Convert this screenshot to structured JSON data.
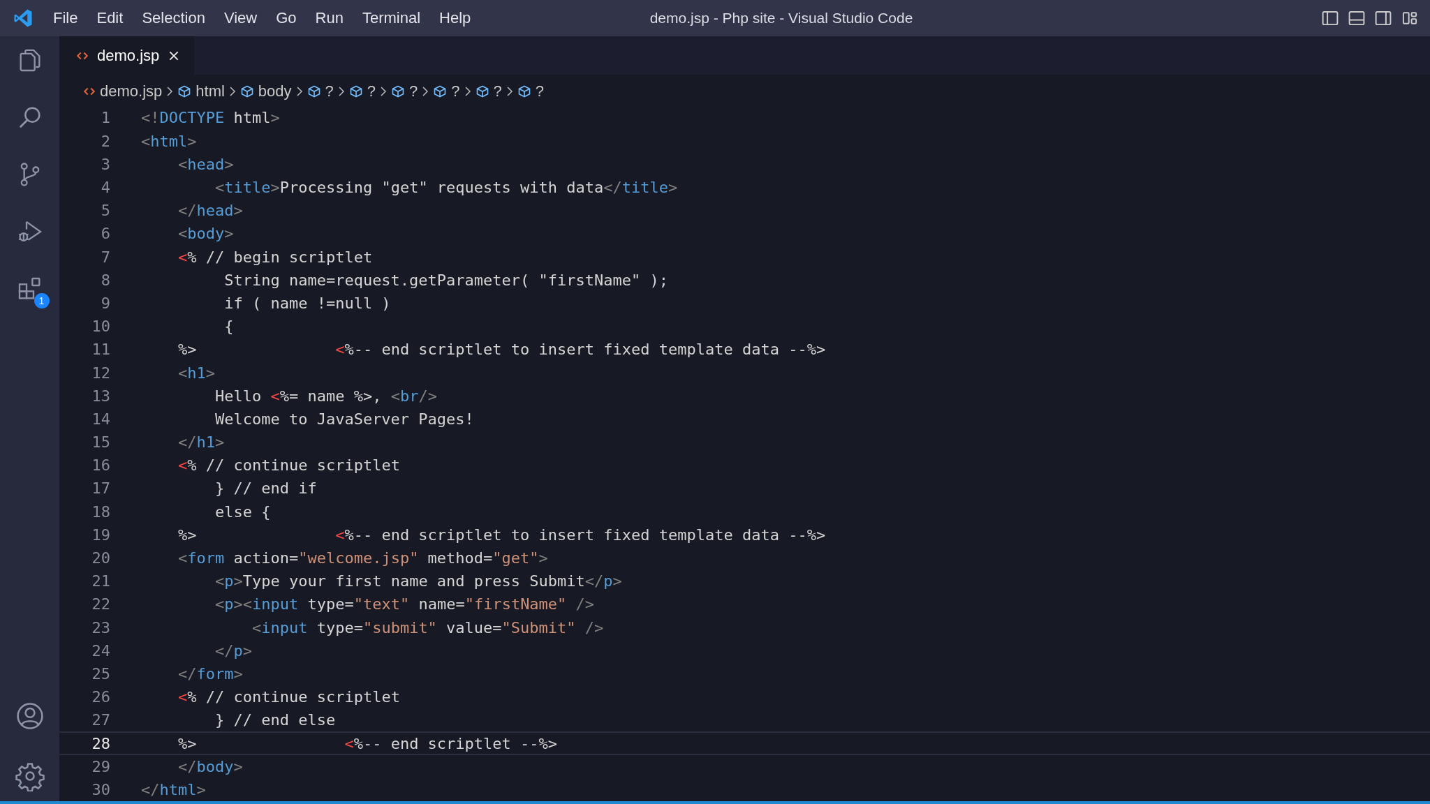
{
  "menu": [
    "File",
    "Edit",
    "Selection",
    "View",
    "Go",
    "Run",
    "Terminal",
    "Help"
  ],
  "window": {
    "title": "demo.jsp - Php site - Visual Studio Code"
  },
  "activity_bar": {
    "top": [
      {
        "kind": "explorer"
      },
      {
        "kind": "search"
      },
      {
        "kind": "source-control"
      },
      {
        "kind": "run-debug"
      },
      {
        "kind": "extensions",
        "badge": "1"
      }
    ],
    "bottom": [
      {
        "kind": "account"
      },
      {
        "kind": "settings"
      }
    ]
  },
  "tabs": [
    {
      "label": "demo.jsp",
      "selected": true
    }
  ],
  "breadcrumbs": [
    {
      "kind": "file",
      "label": "demo.jsp"
    },
    {
      "kind": "element",
      "label": "html"
    },
    {
      "kind": "element",
      "label": "body"
    },
    {
      "kind": "element",
      "label": "?"
    },
    {
      "kind": "element",
      "label": "?"
    },
    {
      "kind": "element",
      "label": "?"
    },
    {
      "kind": "element",
      "label": "?"
    },
    {
      "kind": "element",
      "label": "?"
    },
    {
      "kind": "element",
      "label": "?"
    }
  ],
  "editor": {
    "lines": [
      {
        "number": "1",
        "current": false,
        "tokens": [
          {
            "kind": "punct",
            "text": "<!"
          },
          {
            "kind": "tag",
            "text": "DOCTYPE"
          },
          {
            "kind": "text",
            "text": " html"
          },
          {
            "kind": "punct",
            "text": ">"
          }
        ]
      },
      {
        "number": "2",
        "current": false,
        "tokens": [
          {
            "kind": "punct",
            "text": "<"
          },
          {
            "kind": "tag",
            "text": "html"
          },
          {
            "kind": "punct",
            "text": ">"
          }
        ]
      },
      {
        "number": "3",
        "current": false,
        "tokens": [
          {
            "kind": "punct",
            "text": "    <"
          },
          {
            "kind": "tag",
            "text": "head"
          },
          {
            "kind": "punct",
            "text": ">"
          }
        ]
      },
      {
        "number": "4",
        "current": false,
        "tokens": [
          {
            "kind": "punct",
            "text": "        <"
          },
          {
            "kind": "tag",
            "text": "title"
          },
          {
            "kind": "punct",
            "text": ">"
          },
          {
            "kind": "text",
            "text": "Processing \"get\" requests with data"
          },
          {
            "kind": "punct",
            "text": "</"
          },
          {
            "kind": "tag",
            "text": "title"
          },
          {
            "kind": "punct",
            "text": ">"
          }
        ]
      },
      {
        "number": "5",
        "current": false,
        "tokens": [
          {
            "kind": "punct",
            "text": "    </"
          },
          {
            "kind": "tag",
            "text": "head"
          },
          {
            "kind": "punct",
            "text": ">"
          }
        ]
      },
      {
        "number": "6",
        "current": false,
        "tokens": [
          {
            "kind": "punct",
            "text": "    <"
          },
          {
            "kind": "tag",
            "text": "body"
          },
          {
            "kind": "punct",
            "text": ">"
          }
        ]
      },
      {
        "number": "7",
        "current": false,
        "tokens": [
          {
            "kind": "jsp",
            "text": "    <"
          },
          {
            "kind": "text",
            "text": "% // begin scriptlet"
          }
        ]
      },
      {
        "number": "8",
        "current": false,
        "tokens": [
          {
            "kind": "text",
            "text": "         String name=request.getParameter( \"firstName\" );"
          }
        ]
      },
      {
        "number": "9",
        "current": false,
        "tokens": [
          {
            "kind": "text",
            "text": "         if ( name !=null )"
          }
        ]
      },
      {
        "number": "10",
        "current": false,
        "tokens": [
          {
            "kind": "text",
            "text": "         {"
          }
        ]
      },
      {
        "number": "11",
        "current": false,
        "tokens": [
          {
            "kind": "text",
            "text": "    %>               "
          },
          {
            "kind": "jsp",
            "text": "<"
          },
          {
            "kind": "text",
            "text": "%-- end scriptlet to insert fixed template data --%>"
          }
        ]
      },
      {
        "number": "12",
        "current": false,
        "tokens": [
          {
            "kind": "punct",
            "text": "    <"
          },
          {
            "kind": "tag",
            "text": "h1"
          },
          {
            "kind": "punct",
            "text": ">"
          }
        ]
      },
      {
        "number": "13",
        "current": false,
        "tokens": [
          {
            "kind": "text",
            "text": "        Hello "
          },
          {
            "kind": "jsp",
            "text": "<"
          },
          {
            "kind": "text",
            "text": "%= name %>, "
          },
          {
            "kind": "punct",
            "text": "<"
          },
          {
            "kind": "tag",
            "text": "br"
          },
          {
            "kind": "punct",
            "text": "/>"
          }
        ]
      },
      {
        "number": "14",
        "current": false,
        "tokens": [
          {
            "kind": "text",
            "text": "        Welcome to JavaServer Pages!"
          }
        ]
      },
      {
        "number": "15",
        "current": false,
        "tokens": [
          {
            "kind": "punct",
            "text": "    </"
          },
          {
            "kind": "tag",
            "text": "h1"
          },
          {
            "kind": "punct",
            "text": ">"
          }
        ]
      },
      {
        "number": "16",
        "current": false,
        "tokens": [
          {
            "kind": "jsp",
            "text": "    <"
          },
          {
            "kind": "text",
            "text": "% // continue scriptlet"
          }
        ]
      },
      {
        "number": "17",
        "current": false,
        "tokens": [
          {
            "kind": "text",
            "text": "        } // end if"
          }
        ]
      },
      {
        "number": "18",
        "current": false,
        "tokens": [
          {
            "kind": "text",
            "text": "        else {"
          }
        ]
      },
      {
        "number": "19",
        "current": false,
        "tokens": [
          {
            "kind": "text",
            "text": "    %>               "
          },
          {
            "kind": "jsp",
            "text": "<"
          },
          {
            "kind": "text",
            "text": "%-- end scriptlet to insert fixed template data --%>"
          }
        ]
      },
      {
        "number": "20",
        "current": false,
        "tokens": [
          {
            "kind": "punct",
            "text": "    <"
          },
          {
            "kind": "tag",
            "text": "form"
          },
          {
            "kind": "attr",
            "text": " action="
          },
          {
            "kind": "string",
            "text": "\"welcome.jsp\""
          },
          {
            "kind": "attr",
            "text": " method="
          },
          {
            "kind": "string",
            "text": "\"get\""
          },
          {
            "kind": "punct",
            "text": ">"
          }
        ]
      },
      {
        "number": "21",
        "current": false,
        "tokens": [
          {
            "kind": "punct",
            "text": "        <"
          },
          {
            "kind": "tag",
            "text": "p"
          },
          {
            "kind": "punct",
            "text": ">"
          },
          {
            "kind": "text",
            "text": "Type your first name and press Submit"
          },
          {
            "kind": "punct",
            "text": "</"
          },
          {
            "kind": "tag",
            "text": "p"
          },
          {
            "kind": "punct",
            "text": ">"
          }
        ]
      },
      {
        "number": "22",
        "current": false,
        "tokens": [
          {
            "kind": "punct",
            "text": "        <"
          },
          {
            "kind": "tag",
            "text": "p"
          },
          {
            "kind": "punct",
            "text": "><"
          },
          {
            "kind": "tag",
            "text": "input"
          },
          {
            "kind": "attr",
            "text": " type="
          },
          {
            "kind": "string",
            "text": "\"text\""
          },
          {
            "kind": "attr",
            "text": " name="
          },
          {
            "kind": "string",
            "text": "\"firstName\""
          },
          {
            "kind": "punct",
            "text": " />"
          }
        ]
      },
      {
        "number": "23",
        "current": false,
        "tokens": [
          {
            "kind": "punct",
            "text": "            <"
          },
          {
            "kind": "tag",
            "text": "input"
          },
          {
            "kind": "attr",
            "text": " type="
          },
          {
            "kind": "string",
            "text": "\"submit\""
          },
          {
            "kind": "attr",
            "text": " value="
          },
          {
            "kind": "string",
            "text": "\"Submit\""
          },
          {
            "kind": "punct",
            "text": " />"
          }
        ]
      },
      {
        "number": "24",
        "current": false,
        "tokens": [
          {
            "kind": "punct",
            "text": "        </"
          },
          {
            "kind": "tag",
            "text": "p"
          },
          {
            "kind": "punct",
            "text": ">"
          }
        ]
      },
      {
        "number": "25",
        "current": false,
        "tokens": [
          {
            "kind": "punct",
            "text": "    </"
          },
          {
            "kind": "tag",
            "text": "form"
          },
          {
            "kind": "punct",
            "text": ">"
          }
        ]
      },
      {
        "number": "26",
        "current": false,
        "tokens": [
          {
            "kind": "jsp",
            "text": "    <"
          },
          {
            "kind": "text",
            "text": "% // continue scriptlet"
          }
        ]
      },
      {
        "number": "27",
        "current": false,
        "tokens": [
          {
            "kind": "text",
            "text": "        } // end else"
          }
        ]
      },
      {
        "number": "28",
        "current": true,
        "tokens": [
          {
            "kind": "text",
            "text": "    %>                "
          },
          {
            "kind": "jsp",
            "text": "<"
          },
          {
            "kind": "text",
            "text": "%-- end scriptlet --%>"
          }
        ]
      },
      {
        "number": "29",
        "current": false,
        "tokens": [
          {
            "kind": "punct",
            "text": "    </"
          },
          {
            "kind": "tag",
            "text": "body"
          },
          {
            "kind": "punct",
            "text": ">"
          }
        ]
      },
      {
        "number": "30",
        "current": false,
        "tokens": [
          {
            "kind": "punct",
            "text": "</"
          },
          {
            "kind": "tag",
            "text": "html"
          },
          {
            "kind": "punct",
            "text": ">"
          }
        ]
      }
    ]
  }
}
